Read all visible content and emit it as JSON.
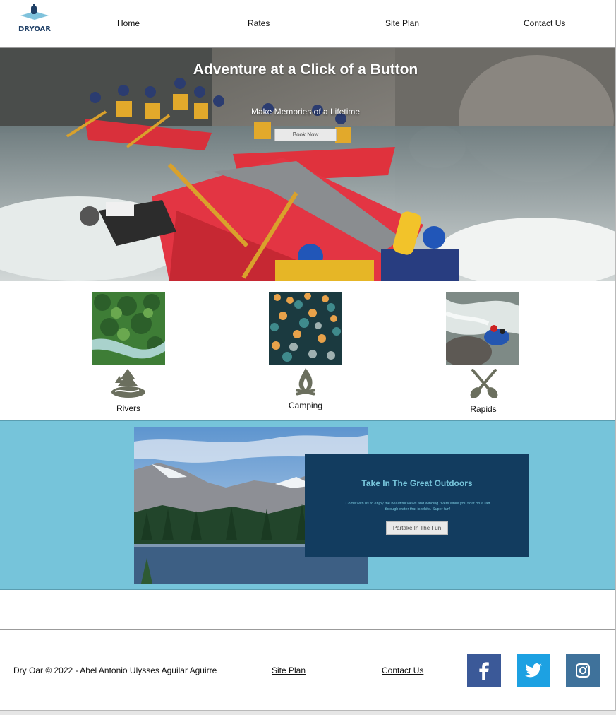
{
  "brand": {
    "logo_text": "DRYOAR"
  },
  "nav": {
    "home": "Home",
    "rates": "Rates",
    "site_plan": "Site Plan",
    "contact": "Contact Us"
  },
  "hero": {
    "title": "Adventure at a Click of a Button",
    "subtitle": "Make Memories of a Lifetime",
    "button": "Book Now"
  },
  "features": [
    {
      "label": "Rivers",
      "icon": "pine-tree-river-icon"
    },
    {
      "label": "Camping",
      "icon": "campfire-icon"
    },
    {
      "label": "Rapids",
      "icon": "crossed-paddles-icon"
    }
  ],
  "outdoors": {
    "title": "Take In The Great Outdoors",
    "text": "Come with us to enjoy the beautiful views and winding rivers while you float on a raft through water that is white. Super fun!",
    "button": "Partake In The Fun"
  },
  "footer": {
    "copyright": "Dry Oar © 2022 - Abel Antonio Ulysses Aguilar Aguirre",
    "site_plan": "Site Plan",
    "contact": "Contact Us",
    "social": [
      {
        "name": "facebook-icon",
        "color": "#3b5998"
      },
      {
        "name": "twitter-icon",
        "color": "#1da1e2"
      },
      {
        "name": "instagram-icon",
        "color": "#3f729b"
      }
    ]
  },
  "colors": {
    "band": "#76c4da",
    "card": "#123c5f",
    "accent_text": "#76c4da"
  }
}
